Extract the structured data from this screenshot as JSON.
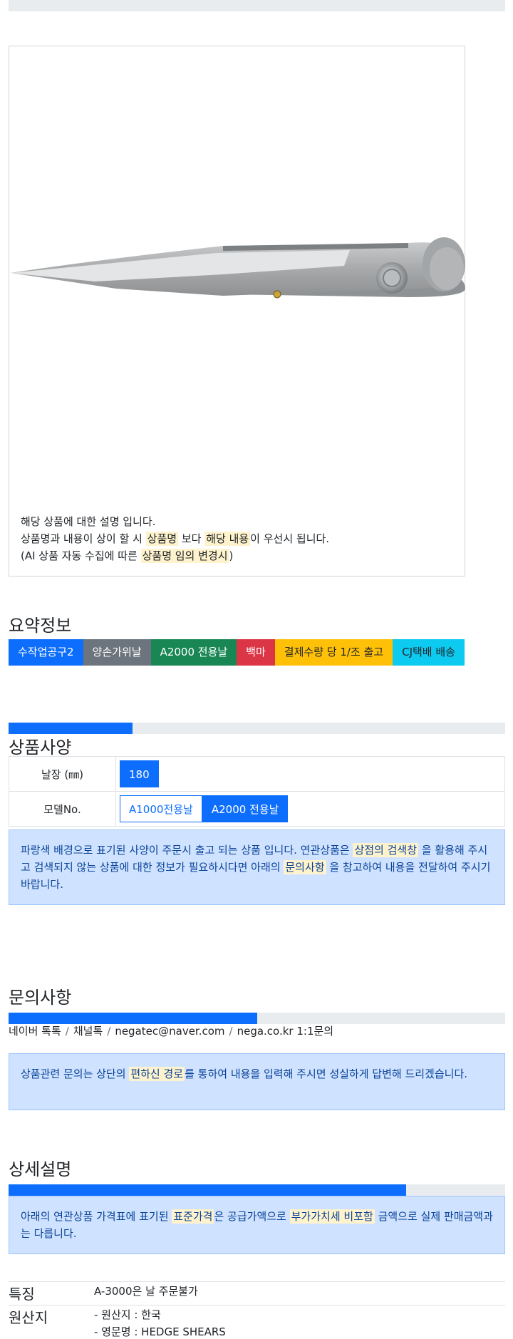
{
  "product": {
    "image_alt": "hedge shears blade",
    "desc_line1": "해당 상품에 대한 설명 입니다.",
    "desc_line2_a": "상품명과 내용이 상이 할 시 ",
    "desc_line2_hl1": "상품명",
    "desc_line2_b": " 보다 ",
    "desc_line2_hl2": "해당 내용",
    "desc_line2_c": "이 우선시 됩니다.",
    "desc_line3_a": "(AI 상품 자동 수집에 따른 ",
    "desc_line3_hl": "상품명 임의 변경시",
    "desc_line3_b": ")"
  },
  "summary": {
    "title": "요약정보",
    "tags": [
      {
        "label": "수작업공구2",
        "color": "#0d6efd"
      },
      {
        "label": "양손가위날",
        "color": "#6c757d"
      },
      {
        "label": "A2000 전용날",
        "color": "#198754"
      },
      {
        "label": "백마",
        "color": "#dc3545"
      },
      {
        "label": "결제수량 당 1/조 출고",
        "color": "#ffc107"
      },
      {
        "label": "CJ택배 배송",
        "color": "#0dcaf0"
      }
    ]
  },
  "spec": {
    "progress_pct": 25,
    "title": "상품사양",
    "rows": [
      {
        "label": "날장 (㎜)",
        "options": [
          {
            "label": "180",
            "selected": true
          }
        ]
      },
      {
        "label": "모델No.",
        "options": [
          {
            "label": "A1000전용날",
            "selected": false
          },
          {
            "label": "A2000 전용날",
            "selected": true
          }
        ]
      }
    ],
    "note_a": "파랑색 배경으로 표기된 사양이 주문시 출고 되는 상품 입니다. 연관상품은 ",
    "note_hl1": "상점의 검색창",
    "note_b": " 을 활용해 주시고 검색되지 않는 상품에 대한 정보가 필요하시다면 아래의 ",
    "note_hl2": "문의사항",
    "note_c": " 을 참고하여 내용을 전달하여 주시기 바랍니다."
  },
  "inquiry": {
    "title": "문의사항",
    "progress_pct": 50,
    "contacts": [
      "네이버 톡톡",
      "채널톡",
      "negatec@naver.com",
      "nega.co.kr 1:1문의"
    ],
    "note_a": "상품관련 문의는 상단의 ",
    "note_hl": "편하신 경로",
    "note_b": "를 통하여 내용을 입력해 주시면 성실하게 답변해 드리겠습니다."
  },
  "detail": {
    "title": "상세설명",
    "progress_pct": 80,
    "note_a": "아래의 연관상품 가격표에 표기된 ",
    "note_hl1": "표준가격",
    "note_b": "은 공급가액으로 ",
    "note_hl2": "부가가치세 비포함",
    "note_c": " 금액으로 실제 판매금액과는 다릅니다."
  },
  "features": {
    "rows": [
      {
        "label": "특징",
        "lines": [
          "A-3000은 날 주문불가"
        ]
      },
      {
        "label": "원산지",
        "lines": [
          "- 원산지 : 한국",
          "- 영문명 : HEDGE SHEARS"
        ]
      }
    ]
  }
}
